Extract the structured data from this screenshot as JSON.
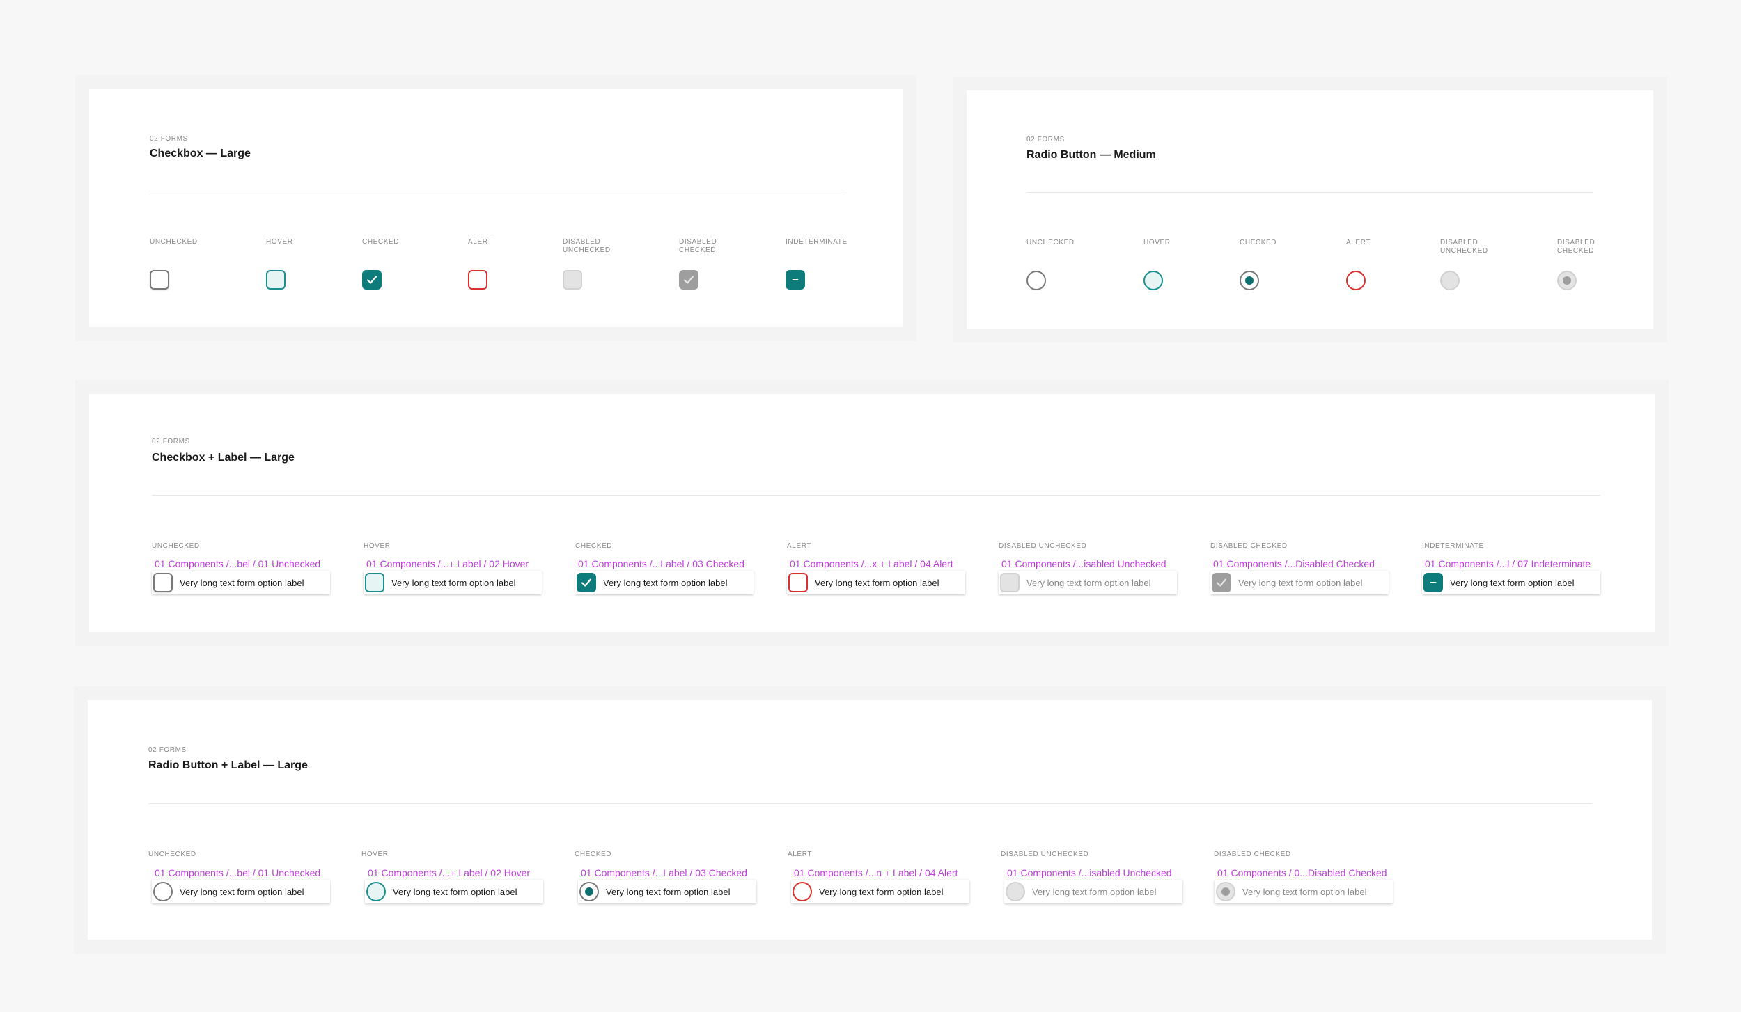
{
  "colors": {
    "accent": "#0e7c7b",
    "alert": "#d93030",
    "component_name": "#c23de0",
    "disabled": "#9e9e9e"
  },
  "icons": {
    "check": "check-icon",
    "indeterminate": "minus-icon"
  },
  "checkbox_large": {
    "overline": "02 FORMS",
    "title": "Checkbox — Large",
    "states": [
      {
        "label": "UNCHECKED"
      },
      {
        "label": "HOVER"
      },
      {
        "label": "CHECKED"
      },
      {
        "label": "ALERT"
      },
      {
        "label": "DISABLED UNCHECKED"
      },
      {
        "label": "DISABLED CHECKED"
      },
      {
        "label": "INDETERMINATE"
      }
    ]
  },
  "radio_medium": {
    "overline": "02 FORMS",
    "title": "Radio Button — Medium",
    "states": [
      {
        "label": "UNCHECKED"
      },
      {
        "label": "HOVER"
      },
      {
        "label": "CHECKED"
      },
      {
        "label": "ALERT"
      },
      {
        "label": "DISABLED UNCHECKED"
      },
      {
        "label": "DISABLED CHECKED"
      }
    ]
  },
  "checkbox_label": {
    "overline": "02 FORMS",
    "title": "Checkbox + Label — Large",
    "items": [
      {
        "state": "UNCHECKED",
        "component": "01 Components /...bel / 01 Unchecked",
        "text": "Very long text form option label"
      },
      {
        "state": "HOVER",
        "component": "01 Components /...+ Label / 02 Hover",
        "text": "Very long text form option label"
      },
      {
        "state": "CHECKED",
        "component": "01 Components /...Label / 03 Checked",
        "text": "Very long text form option label"
      },
      {
        "state": "ALERT",
        "component": "01 Components /...x + Label / 04 Alert",
        "text": "Very long text form option label"
      },
      {
        "state": "DISABLED UNCHECKED",
        "component": "01 Components /...isabled Unchecked",
        "text": "Very long text form option label"
      },
      {
        "state": "DISABLED CHECKED",
        "component": "01 Components /...Disabled Checked",
        "text": "Very long text form option label"
      },
      {
        "state": "INDETERMINATE",
        "component": "01 Components /...l / 07 Indeterminate",
        "text": "Very long text form option label"
      }
    ]
  },
  "radio_label": {
    "overline": "02 FORMS",
    "title": "Radio Button + Label — Large",
    "items": [
      {
        "state": "UNCHECKED",
        "component": "01 Components /...bel / 01 Unchecked",
        "text": "Very long text form option label"
      },
      {
        "state": "HOVER",
        "component": "01 Components /...+ Label / 02 Hover",
        "text": "Very long text form option label"
      },
      {
        "state": "CHECKED",
        "component": "01 Components /...Label / 03 Checked",
        "text": "Very long text form option label"
      },
      {
        "state": "ALERT",
        "component": "01 Components /...n + Label / 04 Alert",
        "text": "Very long text form option label"
      },
      {
        "state": "DISABLED UNCHECKED",
        "component": "01 Components /...isabled Unchecked",
        "text": "Very long text form option label"
      },
      {
        "state": "DISABLED CHECKED",
        "component": "01 Components / 0...Disabled Checked",
        "text": "Very long text form option label"
      }
    ]
  }
}
